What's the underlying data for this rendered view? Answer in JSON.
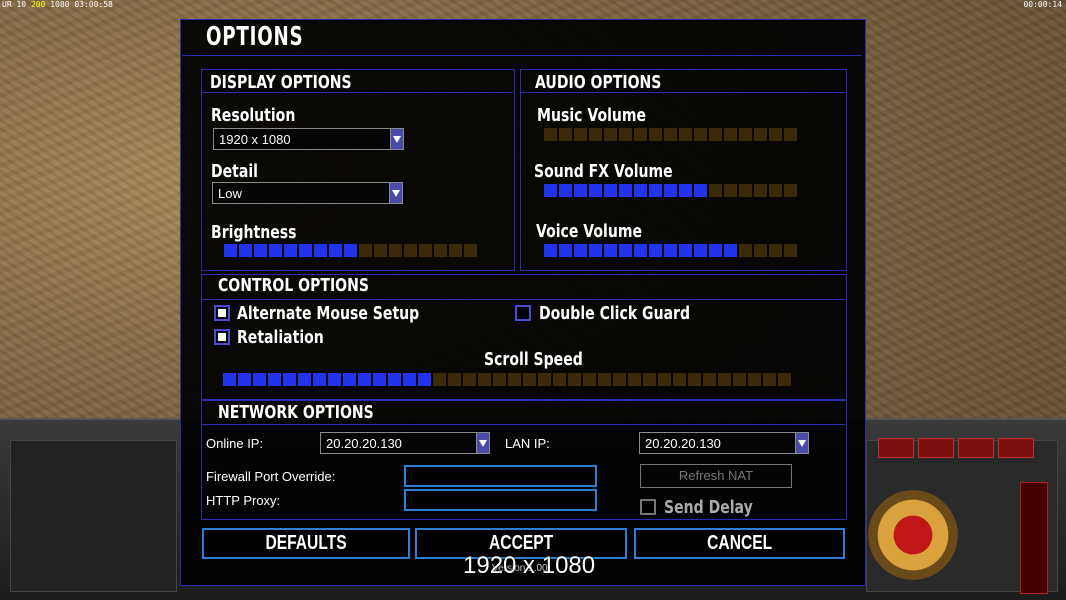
{
  "topbar": {
    "left_prefix": "UR",
    "left_a": "10",
    "left_b": "200",
    "left_c": "1080",
    "left_time": "03:00:58",
    "right_time": "00:00:14"
  },
  "title": "OPTIONS",
  "display": {
    "header": "DISPLAY OPTIONS",
    "resolution_label": "Resolution",
    "resolution_value": "1920 x 1080",
    "detail_label": "Detail",
    "detail_value": "Low",
    "brightness_label": "Brightness",
    "brightness_level": 9,
    "brightness_total": 17
  },
  "audio": {
    "header": "AUDIO OPTIONS",
    "music_label": "Music Volume",
    "music_level": 0,
    "music_total": 17,
    "sfx_label": "Sound FX Volume",
    "sfx_level": 11,
    "sfx_total": 17,
    "voice_label": "Voice Volume",
    "voice_level": 13,
    "voice_total": 17
  },
  "control": {
    "header": "CONTROL OPTIONS",
    "alt_mouse_label": "Alternate Mouse Setup",
    "alt_mouse_checked": true,
    "retaliation_label": "Retaliation",
    "retaliation_checked": true,
    "double_click_label": "Double Click Guard",
    "double_click_checked": false,
    "scroll_label": "Scroll Speed",
    "scroll_level": 14,
    "scroll_total": 38
  },
  "network": {
    "header": "NETWORK OPTIONS",
    "online_ip_label": "Online IP:",
    "online_ip_value": "20.20.20.130",
    "lan_ip_label": "LAN IP:",
    "lan_ip_value": "20.20.20.130",
    "firewall_label": "Firewall Port Override:",
    "firewall_value": "",
    "proxy_label": "HTTP Proxy:",
    "proxy_value": "",
    "refresh_nat_label": "Refresh NAT",
    "send_delay_label": "Send Delay",
    "send_delay_checked": false
  },
  "buttons": {
    "defaults": "DEFAULTS",
    "accept": "ACCEPT",
    "cancel": "CANCEL"
  },
  "version": "Version 1.00",
  "overlay_resolution": "1920 x 1080",
  "colors": {
    "frame_blue": "#2b2bb0",
    "button_blue": "#2c7fd6",
    "slider_on": "#2233ee",
    "slider_off": "#3a2a08"
  }
}
